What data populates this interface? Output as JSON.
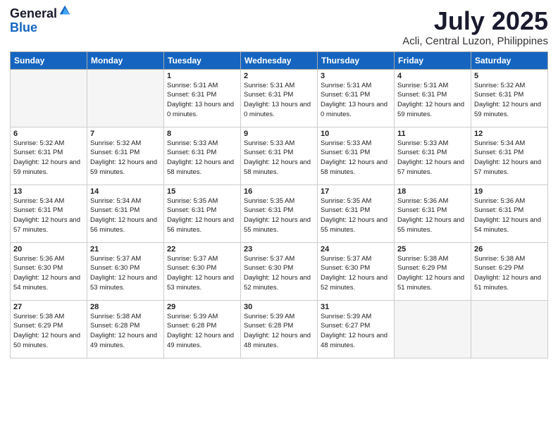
{
  "header": {
    "logo_general": "General",
    "logo_blue": "Blue",
    "month_title": "July 2025",
    "location": "Acli, Central Luzon, Philippines"
  },
  "days_of_week": [
    "Sunday",
    "Monday",
    "Tuesday",
    "Wednesday",
    "Thursday",
    "Friday",
    "Saturday"
  ],
  "weeks": [
    [
      {
        "day": "",
        "info": ""
      },
      {
        "day": "",
        "info": ""
      },
      {
        "day": "1",
        "sunrise": "5:31 AM",
        "sunset": "6:31 PM",
        "daylight": "13 hours and 0 minutes."
      },
      {
        "day": "2",
        "sunrise": "5:31 AM",
        "sunset": "6:31 PM",
        "daylight": "13 hours and 0 minutes."
      },
      {
        "day": "3",
        "sunrise": "5:31 AM",
        "sunset": "6:31 PM",
        "daylight": "13 hours and 0 minutes."
      },
      {
        "day": "4",
        "sunrise": "5:31 AM",
        "sunset": "6:31 PM",
        "daylight": "12 hours and 59 minutes."
      },
      {
        "day": "5",
        "sunrise": "5:32 AM",
        "sunset": "6:31 PM",
        "daylight": "12 hours and 59 minutes."
      }
    ],
    [
      {
        "day": "6",
        "sunrise": "5:32 AM",
        "sunset": "6:31 PM",
        "daylight": "12 hours and 59 minutes."
      },
      {
        "day": "7",
        "sunrise": "5:32 AM",
        "sunset": "6:31 PM",
        "daylight": "12 hours and 59 minutes."
      },
      {
        "day": "8",
        "sunrise": "5:33 AM",
        "sunset": "6:31 PM",
        "daylight": "12 hours and 58 minutes."
      },
      {
        "day": "9",
        "sunrise": "5:33 AM",
        "sunset": "6:31 PM",
        "daylight": "12 hours and 58 minutes."
      },
      {
        "day": "10",
        "sunrise": "5:33 AM",
        "sunset": "6:31 PM",
        "daylight": "12 hours and 58 minutes."
      },
      {
        "day": "11",
        "sunrise": "5:33 AM",
        "sunset": "6:31 PM",
        "daylight": "12 hours and 57 minutes."
      },
      {
        "day": "12",
        "sunrise": "5:34 AM",
        "sunset": "6:31 PM",
        "daylight": "12 hours and 57 minutes."
      }
    ],
    [
      {
        "day": "13",
        "sunrise": "5:34 AM",
        "sunset": "6:31 PM",
        "daylight": "12 hours and 57 minutes."
      },
      {
        "day": "14",
        "sunrise": "5:34 AM",
        "sunset": "6:31 PM",
        "daylight": "12 hours and 56 minutes."
      },
      {
        "day": "15",
        "sunrise": "5:35 AM",
        "sunset": "6:31 PM",
        "daylight": "12 hours and 56 minutes."
      },
      {
        "day": "16",
        "sunrise": "5:35 AM",
        "sunset": "6:31 PM",
        "daylight": "12 hours and 55 minutes."
      },
      {
        "day": "17",
        "sunrise": "5:35 AM",
        "sunset": "6:31 PM",
        "daylight": "12 hours and 55 minutes."
      },
      {
        "day": "18",
        "sunrise": "5:36 AM",
        "sunset": "6:31 PM",
        "daylight": "12 hours and 55 minutes."
      },
      {
        "day": "19",
        "sunrise": "5:36 AM",
        "sunset": "6:31 PM",
        "daylight": "12 hours and 54 minutes."
      }
    ],
    [
      {
        "day": "20",
        "sunrise": "5:36 AM",
        "sunset": "6:30 PM",
        "daylight": "12 hours and 54 minutes."
      },
      {
        "day": "21",
        "sunrise": "5:37 AM",
        "sunset": "6:30 PM",
        "daylight": "12 hours and 53 minutes."
      },
      {
        "day": "22",
        "sunrise": "5:37 AM",
        "sunset": "6:30 PM",
        "daylight": "12 hours and 53 minutes."
      },
      {
        "day": "23",
        "sunrise": "5:37 AM",
        "sunset": "6:30 PM",
        "daylight": "12 hours and 52 minutes."
      },
      {
        "day": "24",
        "sunrise": "5:37 AM",
        "sunset": "6:30 PM",
        "daylight": "12 hours and 52 minutes."
      },
      {
        "day": "25",
        "sunrise": "5:38 AM",
        "sunset": "6:29 PM",
        "daylight": "12 hours and 51 minutes."
      },
      {
        "day": "26",
        "sunrise": "5:38 AM",
        "sunset": "6:29 PM",
        "daylight": "12 hours and 51 minutes."
      }
    ],
    [
      {
        "day": "27",
        "sunrise": "5:38 AM",
        "sunset": "6:29 PM",
        "daylight": "12 hours and 50 minutes."
      },
      {
        "day": "28",
        "sunrise": "5:38 AM",
        "sunset": "6:28 PM",
        "daylight": "12 hours and 49 minutes."
      },
      {
        "day": "29",
        "sunrise": "5:39 AM",
        "sunset": "6:28 PM",
        "daylight": "12 hours and 49 minutes."
      },
      {
        "day": "30",
        "sunrise": "5:39 AM",
        "sunset": "6:28 PM",
        "daylight": "12 hours and 48 minutes."
      },
      {
        "day": "31",
        "sunrise": "5:39 AM",
        "sunset": "6:27 PM",
        "daylight": "12 hours and 48 minutes."
      },
      {
        "day": "",
        "info": ""
      },
      {
        "day": "",
        "info": ""
      }
    ]
  ]
}
